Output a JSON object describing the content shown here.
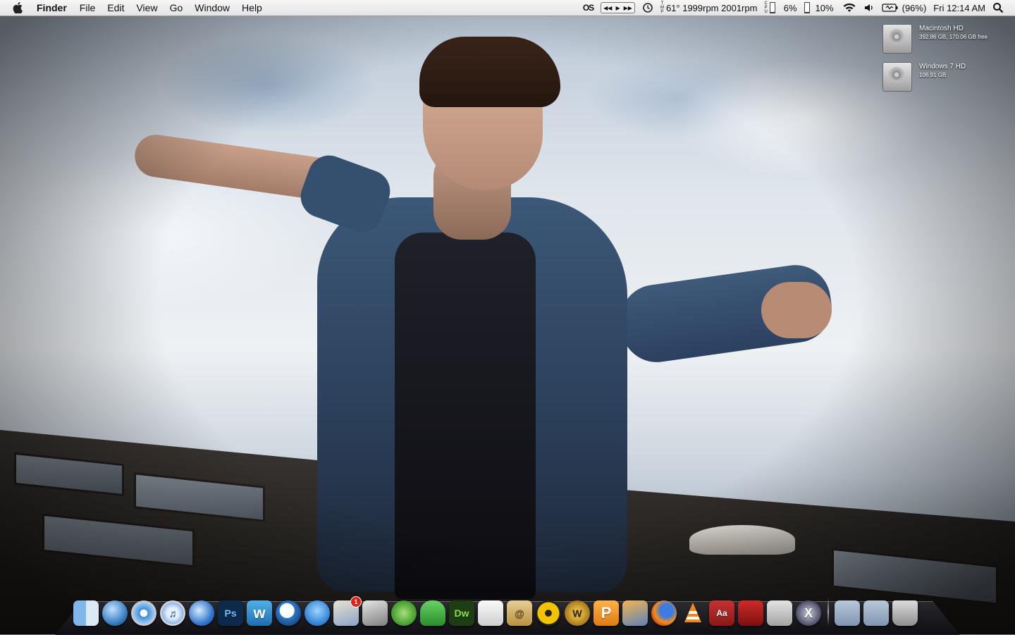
{
  "menubar": {
    "app_name": "Finder",
    "items": [
      "File",
      "Edit",
      "View",
      "Go",
      "Window",
      "Help"
    ]
  },
  "status": {
    "istat_label": "OS",
    "temp_label_top": "T",
    "temp_label_mid": "M",
    "temp_label_bot": "P",
    "temperature_fans": "61° 1999rpm 2001rpm",
    "cpu_label_top": "C",
    "cpu_label_mid": "P",
    "cpu_label_bot": "U",
    "cpu_percent": "6%",
    "mem_percent": "10%",
    "battery": "(96%)",
    "clock": "Fri 12:14 AM",
    "cpu_level": 0.06,
    "mem_level": 0.1
  },
  "desktop_icons": [
    {
      "name": "Macintosh HD",
      "detail": "392.86 GB, 170.06 GB free"
    },
    {
      "name": "Windows 7 HD",
      "detail": "106.91 GB"
    }
  ],
  "dock": {
    "mail_badge": "1",
    "glyph_ps": "Ps",
    "glyph_dw": "Dw",
    "glyph_dict": "Aa",
    "glyph_w": "w",
    "glyph_at": "@",
    "glyph_x": "X",
    "glyph_p": "P",
    "glyph_wow": "W"
  },
  "colors": {
    "menubar_top": "#f7f7f7",
    "menubar_bottom": "#e3e3e3",
    "badge_red": "#e0201d"
  }
}
